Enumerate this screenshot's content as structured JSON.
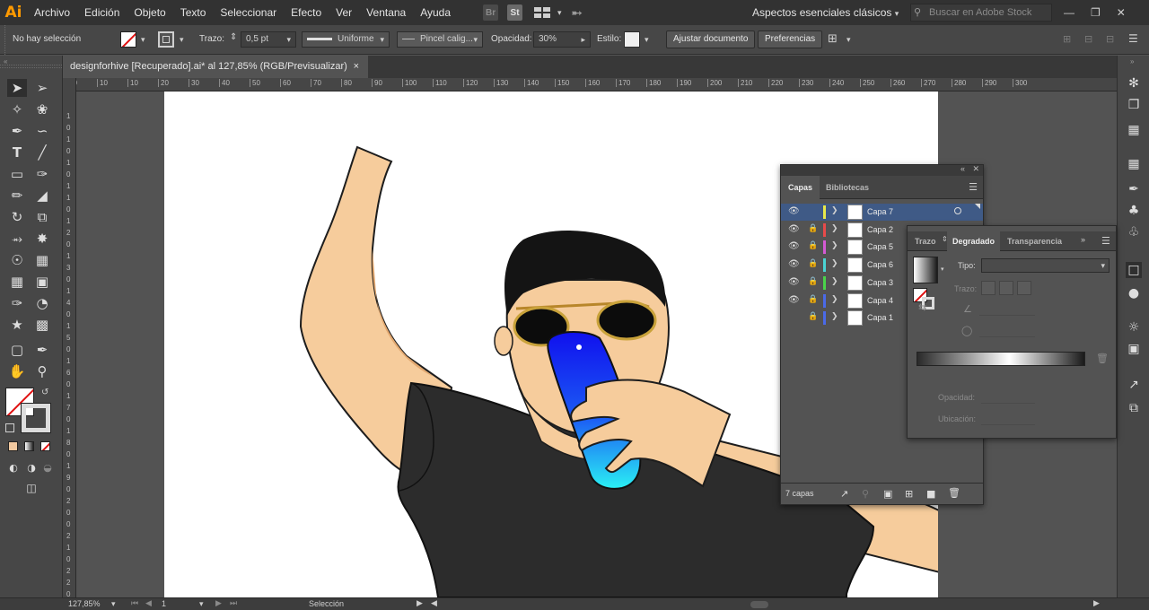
{
  "app": {
    "logo": "Ai",
    "brand_color": "#ff9a00"
  },
  "menu": [
    "Archivo",
    "Edición",
    "Objeto",
    "Texto",
    "Seleccionar",
    "Efecto",
    "Ver",
    "Ventana",
    "Ayuda"
  ],
  "menu_icons": {
    "bridge": "Br",
    "stock": "St"
  },
  "workspace": "Aspectos esenciales clásicos",
  "stock_search_placeholder": "Buscar en Adobe Stock",
  "control": {
    "selection": "No hay selección",
    "stroke_label": "Trazo:",
    "stroke_value": "0,5 pt",
    "profile": "Uniforme",
    "brush": "Pincel calig...",
    "opacity_label": "Opacidad:",
    "opacity_value": "30%",
    "style_label": "Estilo:",
    "adjust_document": "Ajustar documento",
    "preferences": "Preferencias"
  },
  "document_tab": {
    "title": "designforhive [Recuperado].ai* al 127,85% (RGB/Previsualizar)",
    "close": "×"
  },
  "ruler_h": [
    "30",
    "10",
    "10",
    "20",
    "30",
    "40",
    "50",
    "60",
    "70",
    "80",
    "90",
    "100",
    "110",
    "120",
    "130",
    "140",
    "150",
    "160",
    "170",
    "180",
    "190",
    "200",
    "210",
    "220",
    "230",
    "240",
    "250",
    "260",
    "270",
    "280",
    "290",
    "300"
  ],
  "ruler_v": [
    "1",
    "0",
    "1",
    "0",
    "1",
    "0",
    "1",
    "1",
    "0",
    "1",
    "2",
    "0",
    "1",
    "3",
    "0",
    "1",
    "4",
    "0",
    "1",
    "5",
    "0",
    "1",
    "6",
    "0",
    "1",
    "7",
    "0",
    "1",
    "8",
    "0",
    "1",
    "9",
    "0",
    "2",
    "0",
    "0",
    "2",
    "1",
    "0",
    "2",
    "2",
    "0"
  ],
  "layers_panel": {
    "tabs": [
      "Capas",
      "Bibliotecas"
    ],
    "layers": [
      {
        "name": "Capa 7",
        "color": "#e8e84a",
        "visible": true,
        "locked": false,
        "selected": true
      },
      {
        "name": "Capa 2",
        "color": "#e84a4a",
        "visible": true,
        "locked": true,
        "selected": false
      },
      {
        "name": "Capa 5",
        "color": "#d45ad4",
        "visible": true,
        "locked": true,
        "selected": false
      },
      {
        "name": "Capa 6",
        "color": "#4ad4d4",
        "visible": true,
        "locked": true,
        "selected": false
      },
      {
        "name": "Capa 3",
        "color": "#4ad44a",
        "visible": true,
        "locked": true,
        "selected": false
      },
      {
        "name": "Capa 4",
        "color": "#4a6ae8",
        "visible": true,
        "locked": true,
        "selected": false
      },
      {
        "name": "Capa 1",
        "color": "#4a6ae8",
        "visible": false,
        "locked": true,
        "selected": false
      }
    ],
    "count": "7 capas"
  },
  "gradient_panel": {
    "tabs": [
      "Trazo",
      "Degradado",
      "Transparencia"
    ],
    "tipo_label": "Tipo:",
    "trazo_label": "Trazo:",
    "opacity_label": "Opacidad:",
    "location_label": "Ubicación:"
  },
  "status": {
    "zoom": "127,85%",
    "artboard": "1",
    "tool": "Selección"
  }
}
